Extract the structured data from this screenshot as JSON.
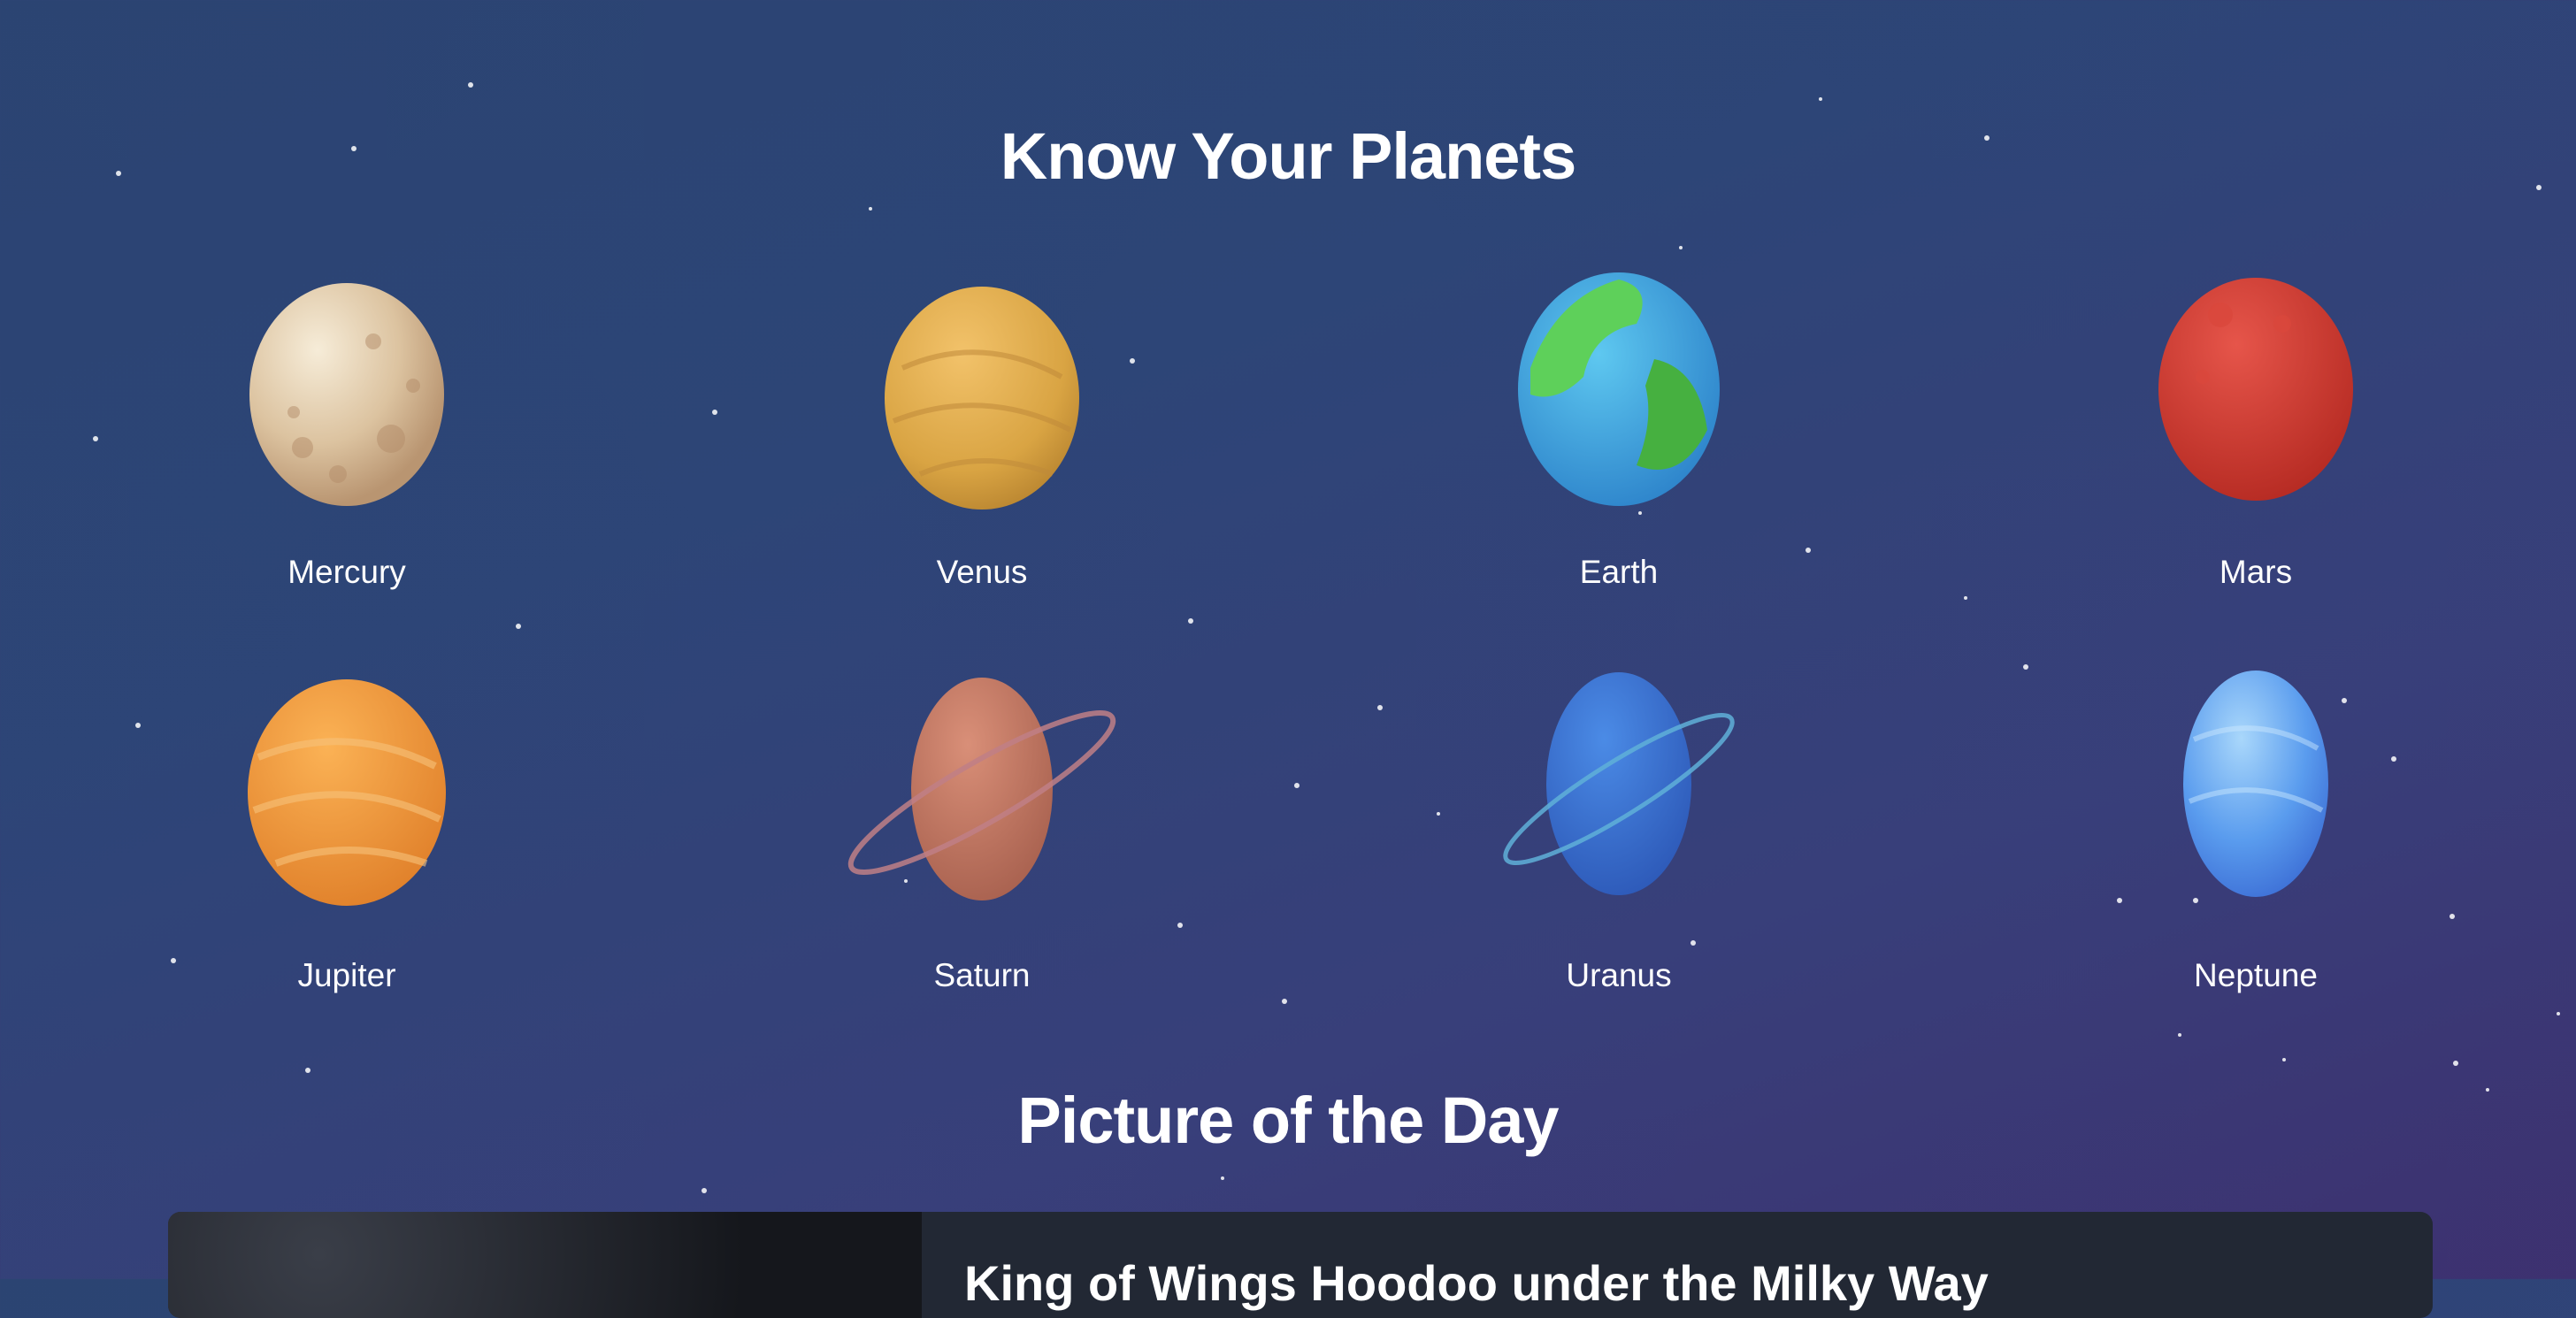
{
  "section_title": "Know Your Planets",
  "planets": [
    {
      "name": "Mercury"
    },
    {
      "name": "Venus"
    },
    {
      "name": "Earth"
    },
    {
      "name": "Mars"
    },
    {
      "name": "Jupiter"
    },
    {
      "name": "Saturn"
    },
    {
      "name": "Uranus"
    },
    {
      "name": "Neptune"
    }
  ],
  "potd": {
    "heading": "Picture of the Day",
    "title": "King of Wings Hoodoo under the Milky Way"
  },
  "colors": {
    "background_top": "#2b4472",
    "background_bottom": "#3d3170",
    "card": "#222834",
    "text": "#ffffff"
  }
}
